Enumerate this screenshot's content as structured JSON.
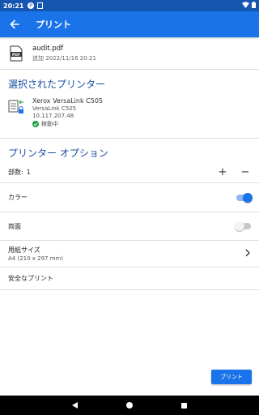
{
  "status_bar": {
    "time": "20:21"
  },
  "app_bar": {
    "title": "プリント"
  },
  "file": {
    "name": "audit.pdf",
    "added": "追加 2022/11/16 20:21",
    "icon_label": "PDF"
  },
  "selected_printer": {
    "section_title": "選択されたプリンター",
    "name": "Xerox VersaLink C505",
    "model": "VersaLink C505",
    "ip": "10.117.207.48",
    "status": "稼動中"
  },
  "options": {
    "section_title": "プリンター オプション",
    "copies_label": "部数:",
    "copies_value": "1",
    "plus": "+",
    "minus": "−",
    "color_label": "カラー",
    "color_on": true,
    "duplex_label": "両面",
    "duplex_on": false,
    "paper_label": "用紙サイズ",
    "paper_value": "A4 (210 x 297 mm)",
    "secure_label": "安全なプリント"
  },
  "print_button": "プリント",
  "colors": {
    "primary": "#1a73e8",
    "status_bar": "#1557b0",
    "section_title": "#1a4fa0",
    "ok": "#1e9e3a"
  }
}
